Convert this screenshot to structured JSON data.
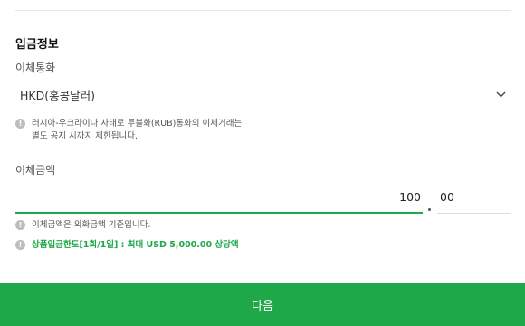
{
  "deposit_info": {
    "title": "입금정보",
    "currency_label": "이체통화",
    "currency_value": "HKD(홍콩달러)",
    "currency_notice": [
      "러시아-우크라이나 사태로 루블화(RUB)통화의 이체거래는",
      "별도 공지 시까지 제한됩니다."
    ],
    "amount_label": "이체금액",
    "amount_integer": "100",
    "amount_decimal": "00",
    "amount_notice": "이체금액은 외화금액 기준입니다.",
    "limit_notice": "상품입금한도[1회/1일] : 최대 USD 5,000.00 상당액"
  },
  "footer": {
    "next_label": "다음"
  },
  "colors": {
    "accent": "#1fa84a",
    "info_icon": "#bdbdbd"
  },
  "icons": {
    "dropdown": "chevron-down-icon",
    "info": "info-icon"
  }
}
